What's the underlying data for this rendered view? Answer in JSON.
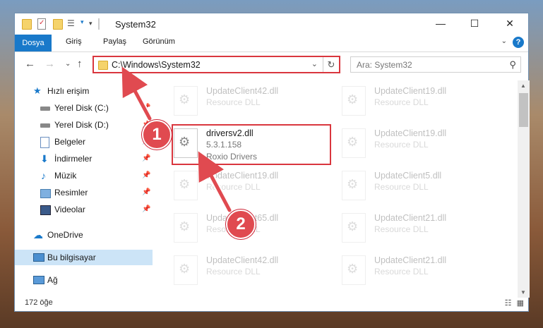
{
  "window": {
    "title": "System32",
    "minimize": "—",
    "maximize": "☐",
    "close": "✕"
  },
  "ribbon": {
    "tabs": [
      "Dosya",
      "Giriş",
      "Paylaş",
      "Görünüm"
    ],
    "help": "?"
  },
  "address": {
    "path": "C:\\Windows\\System32",
    "search_placeholder": "Ara: System32"
  },
  "nav": {
    "items": [
      {
        "label": "Hızlı erişim",
        "icon": "star-icon",
        "pinned": false
      },
      {
        "label": "Yerel Disk (C:)",
        "icon": "drive-icon",
        "pinned": true
      },
      {
        "label": "Yerel Disk (D:)",
        "icon": "drive-icon",
        "pinned": true
      },
      {
        "label": "Belgeler",
        "icon": "document-icon",
        "pinned": true
      },
      {
        "label": "İndirmeler",
        "icon": "download-icon",
        "pinned": true
      },
      {
        "label": "Müzik",
        "icon": "music-icon",
        "pinned": true
      },
      {
        "label": "Resimler",
        "icon": "pictures-icon",
        "pinned": true
      },
      {
        "label": "Videolar",
        "icon": "video-icon",
        "pinned": true
      },
      {
        "label": "OneDrive",
        "icon": "cloud-icon",
        "pinned": false
      },
      {
        "label": "Bu bilgisayar",
        "icon": "computer-icon",
        "pinned": false
      },
      {
        "label": "Ağ",
        "icon": "network-icon",
        "pinned": false
      }
    ]
  },
  "files": [
    {
      "name": "UpdateClient42.dll",
      "line2": "Resource DLL",
      "line3": ""
    },
    {
      "name": "UpdateClient19.dll",
      "line2": "Resource DLL",
      "line3": ""
    },
    {
      "name": "driversv2.dll",
      "line2": "5.3.1.158",
      "line3": "Roxio Drivers"
    },
    {
      "name": "UpdateClient19.dll",
      "line2": "Resource DLL",
      "line3": ""
    },
    {
      "name": "UpdateClient19.dll",
      "line2": "Resource DLL",
      "line3": ""
    },
    {
      "name": "UpdateClient5.dll",
      "line2": "Resource DLL",
      "line3": ""
    },
    {
      "name": "UpdateClient65.dll",
      "line2": "Resource DLL",
      "line3": ""
    },
    {
      "name": "UpdateClient21.dll",
      "line2": "Resource DLL",
      "line3": ""
    },
    {
      "name": "UpdateClient42.dll",
      "line2": "Resource DLL",
      "line3": ""
    },
    {
      "name": "UpdateClient21.dll",
      "line2": "Resource DLL",
      "line3": ""
    }
  ],
  "status": {
    "count": "172 öğe"
  },
  "callouts": [
    "1",
    "2"
  ],
  "colors": {
    "accent": "#1979ca",
    "highlight": "#d9363e",
    "selection": "#cce4f7"
  }
}
